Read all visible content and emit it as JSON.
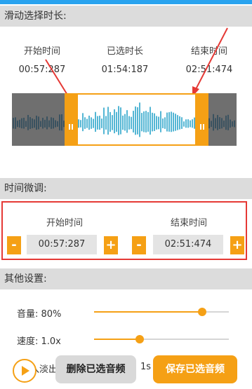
{
  "section1": {
    "title": "滑动选择时长:"
  },
  "times": {
    "start_label": "开始时间",
    "start_value": "00:57:287",
    "selected_label": "已选时长",
    "selected_value": "01:54:187",
    "end_label": "结束时间",
    "end_value": "02:51:474"
  },
  "section2": {
    "title": "时间微调:"
  },
  "tune": {
    "start_label": "开始时间",
    "start_value": "00:57:287",
    "end_label": "结束时间",
    "end_value": "02:51:474",
    "minus": "-",
    "plus": "+"
  },
  "section3": {
    "title": "其他设置:"
  },
  "settings": {
    "volume_label": "音量: 80%",
    "volume_level": 0.8,
    "speed_label": "速度: 1.0x",
    "speed_level": 0.34,
    "fade_label": "淡入淡出",
    "fade_value": "1s"
  },
  "actions": {
    "delete_label": "删除已选音频",
    "save_label": "保存已选音频"
  },
  "colors": {
    "accent": "#f5a015",
    "selection_border": "#e53935",
    "wave": "#29a3c9"
  }
}
